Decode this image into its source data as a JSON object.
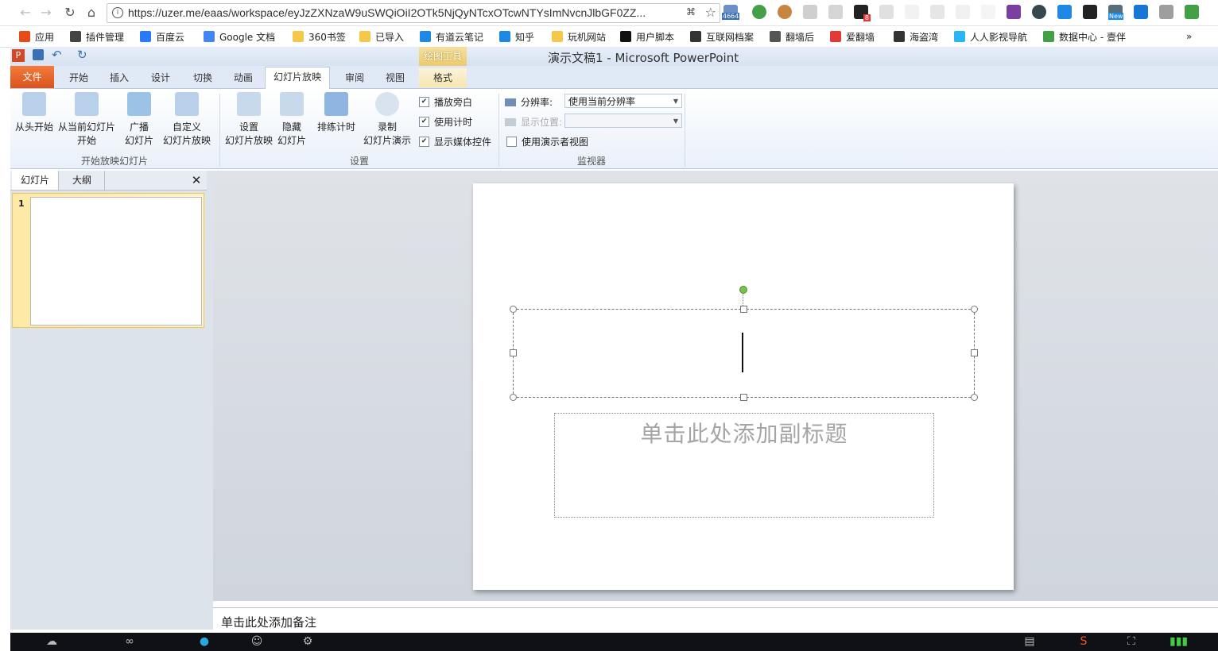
{
  "browser": {
    "url": "https://uzer.me/eaas/workspace/eyJzZXNzaW9uSWQiOiI2OTk5NjQyNTcxOTcwNTYsImNvcnJlbGF0ZZ...",
    "badge_count": "4664",
    "badge_new": "New",
    "badge_8": "8"
  },
  "bookmarks": [
    {
      "label": "应用",
      "color": "#e64a19"
    },
    {
      "label": "插件管理",
      "color": "#444444"
    },
    {
      "label": "百度云",
      "color": "#2979ff"
    },
    {
      "label": "Google 文档",
      "color": "#4285f4"
    },
    {
      "label": "360书签",
      "color": "#f6c84a"
    },
    {
      "label": "已导入",
      "color": "#f6c84a"
    },
    {
      "label": "有道云笔记",
      "color": "#1e88e5"
    },
    {
      "label": "知乎",
      "color": "#1e88e5"
    },
    {
      "label": "玩机网站",
      "color": "#f6c84a"
    },
    {
      "label": "用户脚本",
      "color": "#111111"
    },
    {
      "label": "互联网档案",
      "color": "#333333"
    },
    {
      "label": "翻墙后",
      "color": "#555555"
    },
    {
      "label": "爱翻墙",
      "color": "#e53935"
    },
    {
      "label": "海盗湾",
      "color": "#333333"
    },
    {
      "label": "人人影视导航",
      "color": "#29b6f6"
    },
    {
      "label": "数据中心 - 壹伴",
      "color": "#43a047"
    }
  ],
  "ppt": {
    "window_title": "演示文稿1 - Microsoft PowerPoint",
    "contextual_tab_group": "绘图工具",
    "tabs": [
      "文件",
      "开始",
      "插入",
      "设计",
      "切换",
      "动画",
      "幻灯片放映",
      "审阅",
      "视图",
      "格式"
    ],
    "active_tab": "幻灯片放映"
  },
  "ribbon": {
    "group_start": {
      "label": "开始放映幻灯片",
      "from_beginning": "从头开始",
      "from_current_1": "从当前幻灯片",
      "from_current_2": "开始",
      "broadcast_1": "广播",
      "broadcast_2": "幻灯片",
      "custom_1": "自定义",
      "custom_2": "幻灯片放映"
    },
    "group_setup": {
      "label": "设置",
      "setup_1": "设置",
      "setup_2": "幻灯片放映",
      "hide_1": "隐藏",
      "hide_2": "幻灯片",
      "rehearse": "排练计时",
      "record_1": "录制",
      "record_2": "幻灯片演示",
      "play_narrations": "播放旁白",
      "use_timings": "使用计时",
      "show_media_controls": "显示媒体控件"
    },
    "group_monitors": {
      "label": "监视器",
      "resolution_label": "分辨率:",
      "resolution_value": "使用当前分辨率",
      "show_on_label": "显示位置:",
      "presenter_view": "使用演示者视图"
    }
  },
  "left_panel": {
    "tab_slides": "幻灯片",
    "tab_outline": "大纲",
    "close": "✕",
    "slide_number": "1"
  },
  "slide": {
    "subtitle_placeholder": "单击此处添加副标题"
  },
  "notes": {
    "placeholder": "单击此处添加备注"
  }
}
